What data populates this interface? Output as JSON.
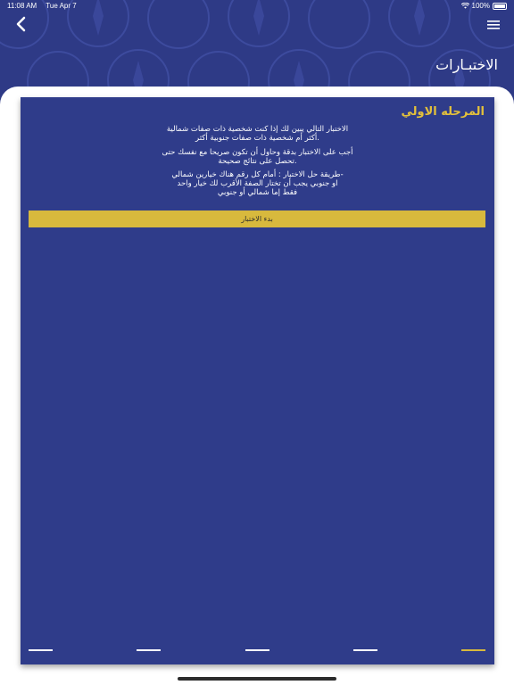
{
  "status_bar": {
    "time": "11:08 AM",
    "date": "Tue Apr 7",
    "battery": "100%",
    "wifi_icon": "wifi-icon",
    "battery_icon": "battery-icon"
  },
  "header": {
    "title": "الاختبـارات",
    "back_icon": "chevron-left-icon",
    "menu_icon": "hamburger-menu-icon"
  },
  "card": {
    "title": "المرحله الاولي",
    "paragraph1_line1": "الاختبار التالي يبين لك إذا كنت شخصية ذات صفات شمالية",
    "paragraph1_line2": "أكثر أم شخصية ذات صفات جنوبية أكثر.",
    "paragraph2_line1": "أجب على الاختبار بدقة وحاول أن تكون صريحا مع نفسك حتى",
    "paragraph2_line2": "تحصل على نتائج صحيحة.",
    "paragraph3_line1": "طريقة حل الاختبار : أمام كل رقم هناك خيارين شمالي-",
    "paragraph3_line2": "او جنوبي يجب أن تختار الصفة الأقرب لك خيار واحد",
    "paragraph3_line3": "فقط إما شمالي أو جنوبي",
    "start_button": "بدء الاختبار"
  },
  "pager": {
    "total": 5,
    "active_index": 5
  },
  "colors": {
    "background": "#2e3a86",
    "card": "#2f3c8a",
    "accent": "#d8b93d",
    "title_gold": "#e4c13b"
  }
}
